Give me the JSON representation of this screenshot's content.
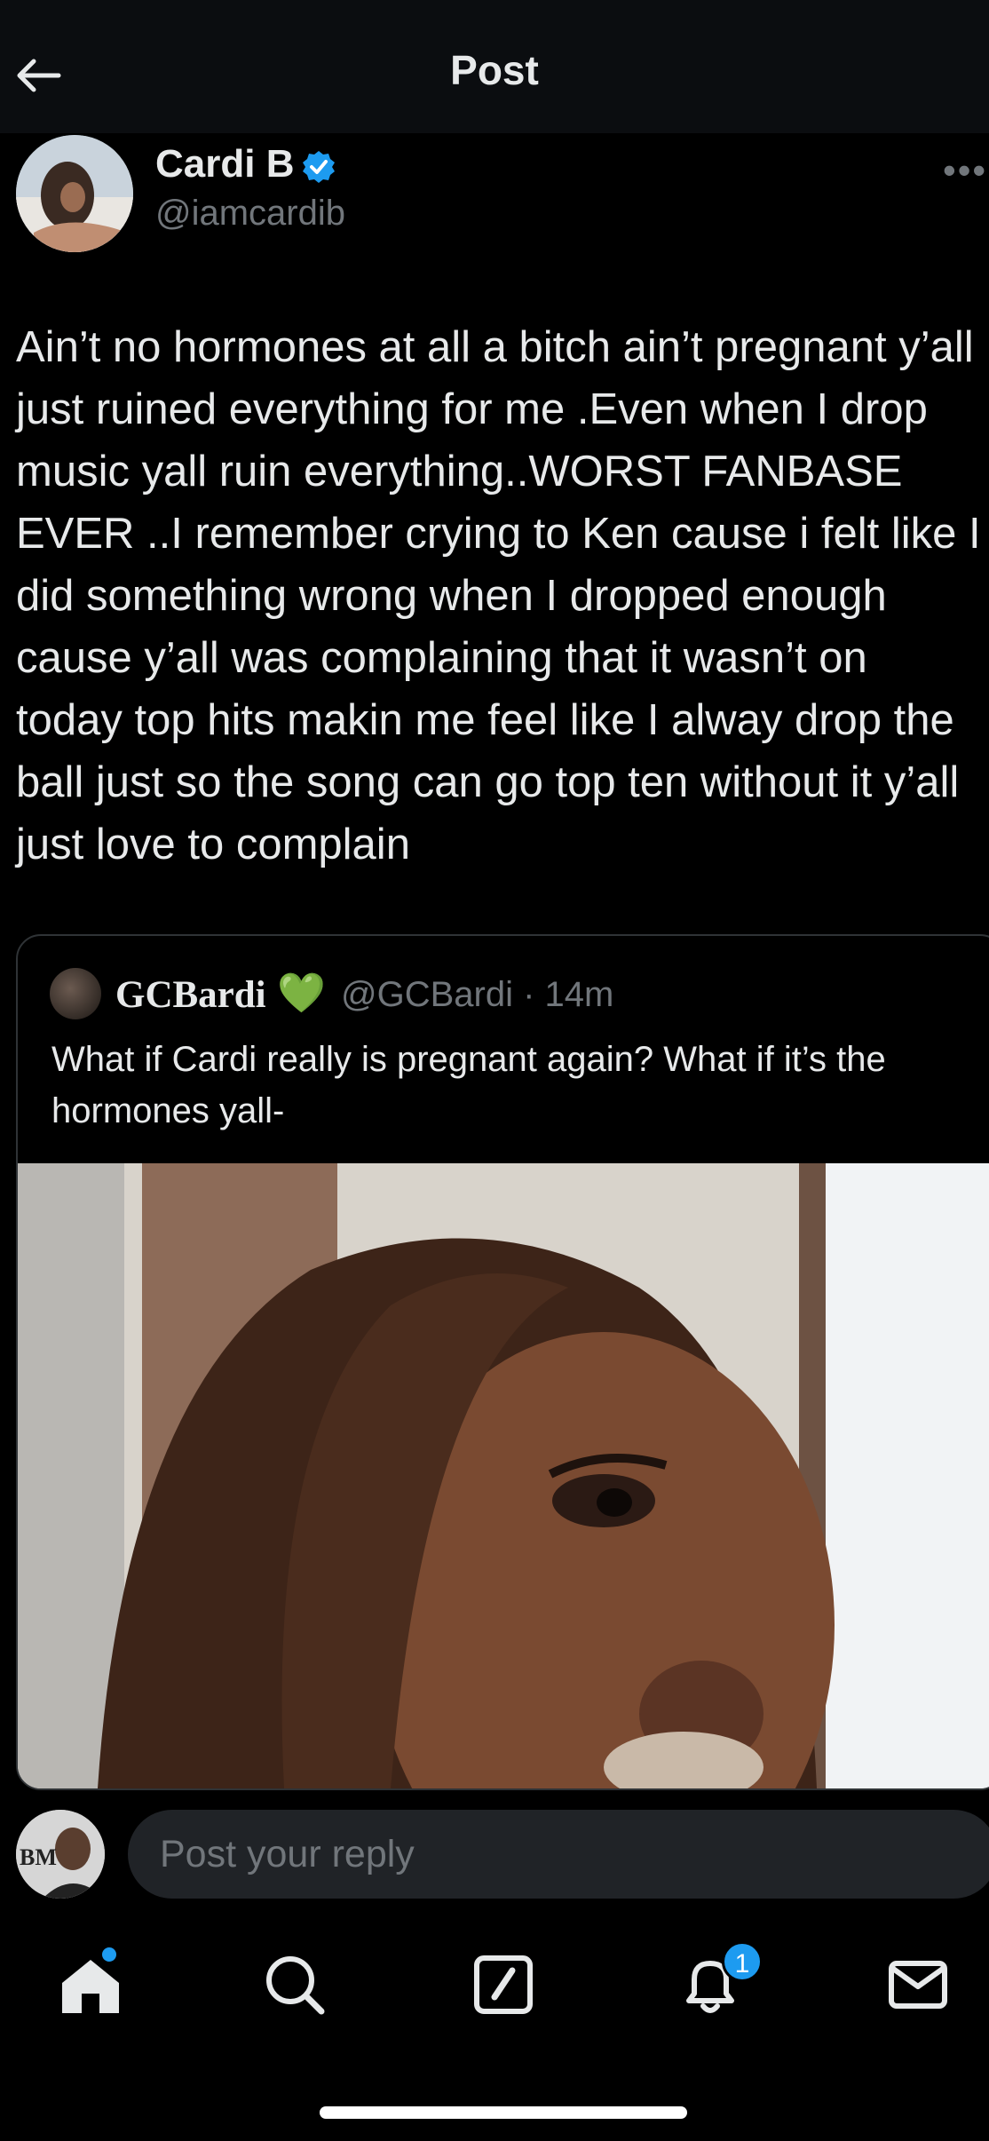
{
  "header": {
    "title": "Post"
  },
  "author": {
    "name": "Cardi B",
    "handle": "@iamcardib",
    "more": "•••"
  },
  "post": {
    "text": "Ain’t no hormones at all a bitch ain’t pregnant y’all just ruined everything for me .Even when I drop music yall ruin everything..WORST FANBASE EVER ..I remember crying  to Ken cause i felt like I did something wrong when I dropped enough cause y’all was complaining that it wasn’t on today top hits makin me feel like I alway drop the ball just so the song can go top ten without it y’all just love to complain"
  },
  "quote": {
    "name": "GCBardi",
    "heart": "💚",
    "handle_time": "@GCBardi · 14m",
    "text": "What if Cardi really is pregnant again? What if it’s the hormones yall-"
  },
  "reply": {
    "placeholder": "Post your reply",
    "avatar_initials": "BM"
  },
  "nav": {
    "notification_count": "1"
  },
  "colors": {
    "accent": "#1d9bf0",
    "background": "#000000",
    "muted": "#71767b",
    "heart": "#2bd13a"
  },
  "icons": [
    "back-arrow-icon",
    "verified-badge-icon",
    "more-icon",
    "home-icon",
    "search-icon",
    "compose-icon",
    "bell-icon",
    "mail-icon"
  ]
}
